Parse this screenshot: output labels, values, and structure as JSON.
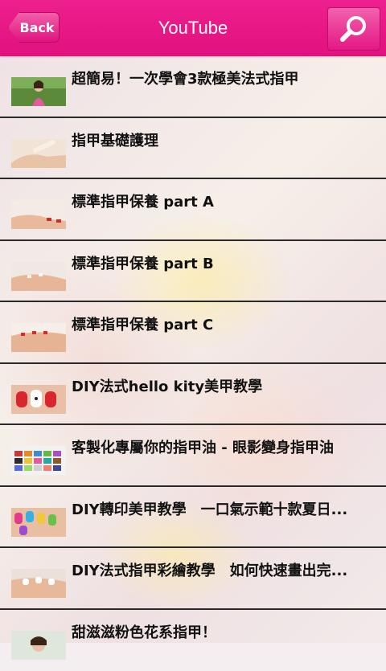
{
  "header": {
    "title": "YouTube",
    "back_label": "Back"
  },
  "colors": {
    "header_pink": "#e8168a",
    "text": "#111111"
  },
  "videos": [
    {
      "title": "超簡易！一次學會3款極美法式指甲",
      "thumb": "thumb-woman-portrait"
    },
    {
      "title": "指甲基礎護理",
      "thumb": "thumb-hand-file"
    },
    {
      "title": "標準指甲保養 part A",
      "thumb": "thumb-hand-care"
    },
    {
      "title": "標準指甲保養 part B",
      "thumb": "thumb-hand-care"
    },
    {
      "title": "標準指甲保養 part C",
      "thumb": "thumb-hand-care"
    },
    {
      "title": "DIY法式hello kity美甲教學",
      "thumb": "thumb-hello-kitty-nails"
    },
    {
      "title": "客製化專屬你的指甲油 - 眼影變身指甲油",
      "thumb": "thumb-eyeshadow-palette"
    },
    {
      "title": "DIY轉印美甲教學　一口氣示範十款夏日...",
      "thumb": "thumb-colorful-nails"
    },
    {
      "title": "DIY法式指甲彩繪教學　如何快速畫出完...",
      "thumb": "thumb-french-nails"
    },
    {
      "title": "甜滋滋粉色花系指甲！",
      "thumb": "thumb-woman-portrait"
    }
  ]
}
